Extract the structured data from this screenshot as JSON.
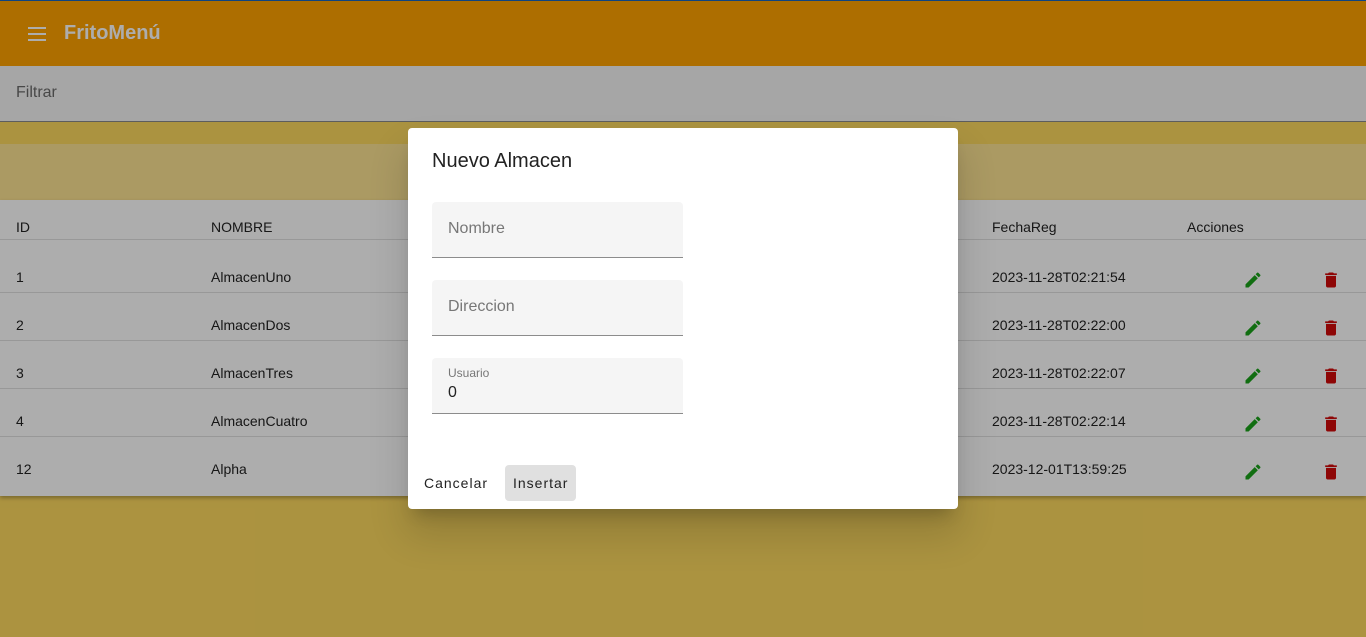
{
  "app": {
    "title": "FritoMenú"
  },
  "filter": {
    "placeholder": "Filtrar"
  },
  "table": {
    "headers": [
      "ID",
      "NOMBRE",
      "FechaReg",
      "Acciones"
    ],
    "rows": [
      {
        "id": "1",
        "nombre": "AlmacenUno",
        "fecha": "2023-11-28T02:21:54"
      },
      {
        "id": "2",
        "nombre": "AlmacenDos",
        "fecha": "2023-11-28T02:22:00"
      },
      {
        "id": "3",
        "nombre": "AlmacenTres",
        "fecha": "2023-11-28T02:22:07"
      },
      {
        "id": "4",
        "nombre": "AlmacenCuatro",
        "fecha": "2023-11-28T02:22:14"
      },
      {
        "id": "12",
        "nombre": "Alpha",
        "fecha": "2023-12-01T13:59:25"
      }
    ]
  },
  "dialog": {
    "title": "Nuevo Almacen",
    "fields": {
      "nombre": {
        "placeholder": "Nombre",
        "value": ""
      },
      "direccion": {
        "placeholder": "Direccion",
        "value": ""
      },
      "usuario": {
        "label": "Usuario",
        "value": "0"
      }
    },
    "cancel_label": "Cancelar",
    "insert_label": "Insertar"
  },
  "icons": {
    "menu": "menu-icon",
    "edit": "pencil-icon",
    "delete": "trash-icon"
  },
  "colors": {
    "toolbar": "#ffa200",
    "edit": "#1aa31a",
    "delete": "#d10a0a",
    "background": "#fdd95f"
  }
}
